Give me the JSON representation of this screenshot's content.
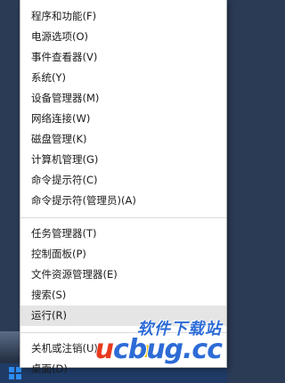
{
  "menu": {
    "groups": [
      {
        "items": [
          "程序和功能(F)",
          "电源选项(O)",
          "事件查看器(V)",
          "系统(Y)",
          "设备管理器(M)",
          "网络连接(W)",
          "磁盘管理(K)",
          "计算机管理(G)",
          "命令提示符(C)",
          "命令提示符(管理员)(A)"
        ]
      },
      {
        "items": [
          "任务管理器(T)",
          "控制面板(P)",
          "文件资源管理器(E)",
          "搜索(S)",
          "运行(R)"
        ]
      },
      {
        "items": [
          "关机或注销(U)",
          "桌面(D)"
        ]
      }
    ],
    "hovered_item": "运行(R)"
  },
  "watermark": {
    "text_cn": "软件下载站",
    "logo_u": "u",
    "logo_rest": "cbug.cc",
    "colors": {
      "blue": "#2d6bd6",
      "red": "#e9391e",
      "yellow": "#f2c200"
    }
  },
  "colors": {
    "menu_bg": "#ffffff",
    "hover_bg": "#e5e5e5",
    "separator": "#d9d9d9",
    "taskbar": "#1f3b66"
  },
  "icons": {
    "start": "windows-logo-icon"
  }
}
